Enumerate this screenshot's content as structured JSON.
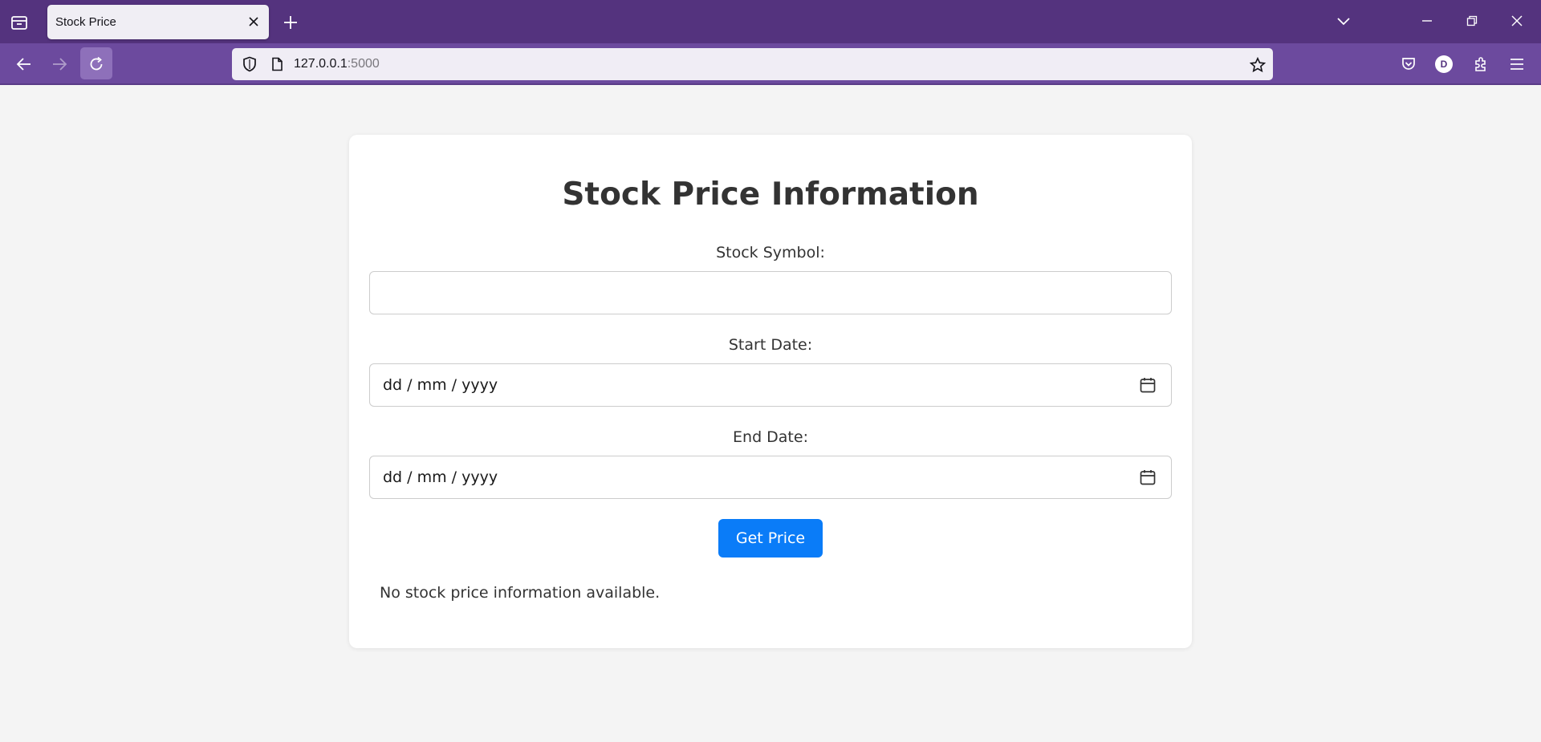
{
  "browser": {
    "tab": {
      "title": "Stock Price"
    },
    "address": {
      "host": "127.0.0.1",
      "port": ":5000"
    },
    "account_initial": "D",
    "icons": [
      "tab-list-icon",
      "close-icon",
      "new-tab-icon",
      "list-all-tabs-icon",
      "minimize-icon",
      "restore-icon",
      "window-close-icon",
      "back-icon",
      "forward-icon",
      "reload-icon",
      "shield-icon",
      "page-icon",
      "bookmark-star-icon",
      "pocket-icon",
      "extensions-icon",
      "menu-icon"
    ],
    "colors": {
      "tab_strip": "#54337e",
      "toolbar": "#6c4a9e",
      "url_field": "#f0edf5"
    }
  },
  "page": {
    "title": "Stock Price Information",
    "form": {
      "symbol_label": "Stock Symbol:",
      "symbol_value": "",
      "start_label": "Start Date:",
      "start_value": "dd / mm / yyyy",
      "end_label": "End Date:",
      "end_value": "dd / mm / yyyy",
      "submit_label": "Get Price"
    },
    "result_message": "No stock price information available.",
    "colors": {
      "background": "#f4f4f4",
      "card": "#ffffff",
      "button": "#0a7cf8",
      "text": "#333333"
    }
  }
}
